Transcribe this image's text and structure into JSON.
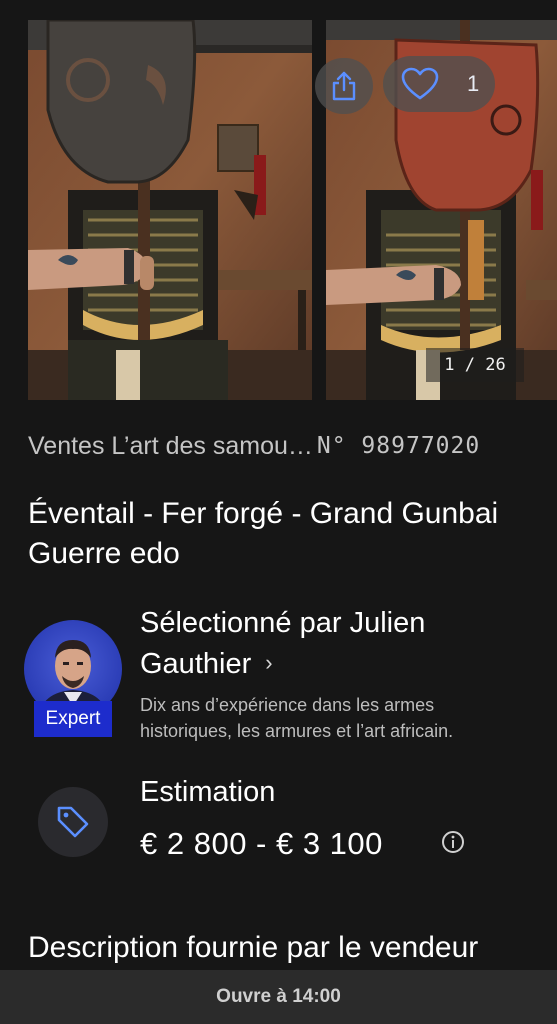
{
  "gallery": {
    "like_count": "1",
    "counter": "1 / 26",
    "current_image": 1,
    "total_images": 26
  },
  "lot": {
    "breadcrumb": "Ventes L’art des samou…",
    "number": "N° 98977020",
    "title": "Éventail - Fer forgé - Grand Gunbai Guerre edo"
  },
  "expert": {
    "badge": "Expert",
    "name": "Sélectionné par Julien Gauthier",
    "bio": "Dix ans d’expérience dans les armes historiques, les armures et l’art africain."
  },
  "estimate": {
    "label": "Estimation",
    "value": "€ 2 800 - € 3 100"
  },
  "description": {
    "heading": "Description fournie par le vendeur"
  },
  "bottom_bar": {
    "status": "Ouvre à 14:00"
  },
  "colors": {
    "background": "#161616",
    "expert_badge": "#1d2ccc",
    "tag_icon": "#5b8fff",
    "bottom_bar": "#2b2b2b"
  },
  "icons": {
    "share": "share-icon",
    "like": "heart-icon",
    "chevron": "chevron-right-icon",
    "tag": "price-tag-icon",
    "info": "info-icon"
  }
}
